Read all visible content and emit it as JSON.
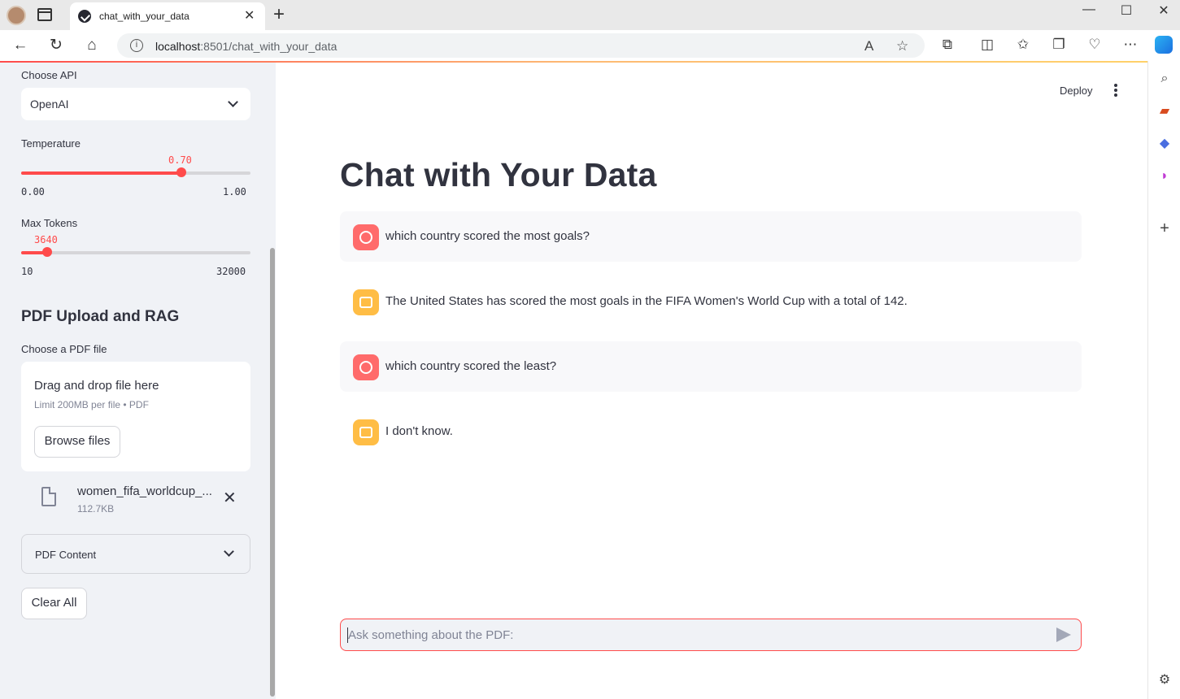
{
  "browser": {
    "tab_title": "chat_with_your_data",
    "url_host": "localhost",
    "url_path": ":8501/chat_with_your_data",
    "new_tab_glyph": "+",
    "close_glyph": "✕",
    "icons": [
      "back-icon",
      "refresh-icon",
      "home-icon",
      "info-icon",
      "read-aloud-icon",
      "favorite-star-icon",
      "extensions-icon",
      "split-screen-icon",
      "favorites-icon",
      "collections-icon",
      "performance-icon",
      "more-icon",
      "copilot-icon"
    ]
  },
  "sidebar": {
    "choose_api_label": "Choose API",
    "api_selected": "OpenAI",
    "temperature": {
      "label": "Temperature",
      "value": "0.70",
      "min": "0.00",
      "max": "1.00",
      "fraction": 0.7
    },
    "max_tokens": {
      "label": "Max Tokens",
      "value": "3640",
      "min": "10",
      "max": "32000",
      "fraction": 0.1135
    },
    "pdf_section_title": "PDF Upload and RAG",
    "pdf_label": "Choose a PDF file",
    "dropzone_title": "Drag and drop file here",
    "dropzone_sub": "Limit 200MB per file • PDF",
    "browse_label": "Browse files",
    "file": {
      "name": "women_fifa_worldcup_...",
      "size": "112.7KB"
    },
    "expander_label": "PDF Content",
    "clear_label": "Clear All"
  },
  "header": {
    "deploy_label": "Deploy"
  },
  "main": {
    "title": "Chat with Your Data",
    "messages": [
      {
        "role": "user",
        "text": "which country scored the most goals?"
      },
      {
        "role": "assistant",
        "text": "The United States has scored the most goals in the FIFA Women's World Cup with a total of 142."
      },
      {
        "role": "user",
        "text": "which country scored the least?"
      },
      {
        "role": "assistant",
        "text": "I don't know."
      }
    ],
    "input_placeholder": "Ask something about the PDF:"
  },
  "colors": {
    "accent": "#ff4b4b",
    "user_avatar": "#ff6b6b",
    "assistant_avatar": "#ffbd45",
    "sidebar_bg": "#f0f2f6"
  }
}
